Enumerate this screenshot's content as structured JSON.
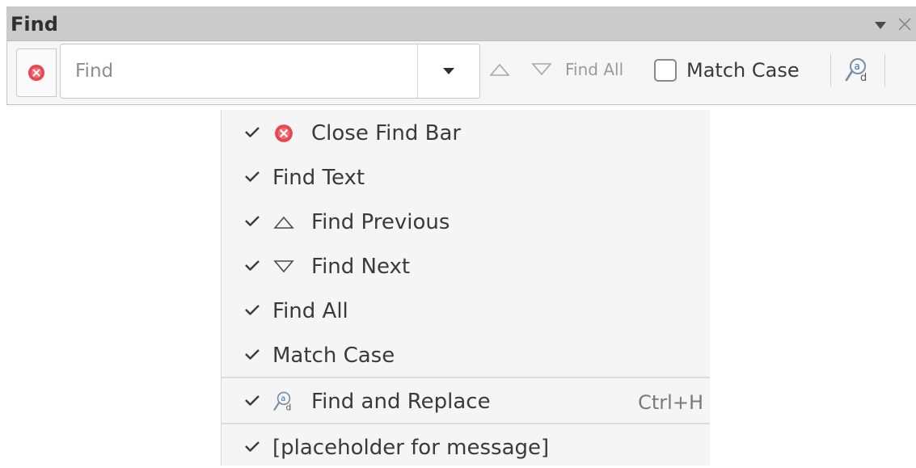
{
  "toolbar": {
    "title": "Find",
    "find_placeholder": "Find",
    "find_value": "",
    "find_all_label": "Find All",
    "match_case_label": "Match Case",
    "match_case_checked": false
  },
  "menu": {
    "items": [
      {
        "label": "Close Find Bar",
        "checked": true,
        "icon": "close-circle-icon"
      },
      {
        "label": "Find Text",
        "checked": true,
        "icon": ""
      },
      {
        "label": "Find Previous",
        "checked": true,
        "icon": "triangle-up-icon"
      },
      {
        "label": "Find Next",
        "checked": true,
        "icon": "triangle-down-icon"
      },
      {
        "label": "Find All",
        "checked": true,
        "icon": ""
      },
      {
        "label": "Match Case",
        "checked": true,
        "icon": ""
      },
      {
        "label": "Find and Replace",
        "checked": true,
        "icon": "find-replace-icon",
        "shortcut": "Ctrl+H"
      },
      {
        "label": "[placeholder for message]",
        "checked": true,
        "icon": ""
      }
    ]
  },
  "colors": {
    "close_icon_red": "#e8474f",
    "title_bar": "#cbcbcb",
    "menu_background": "#f5f5f5"
  }
}
